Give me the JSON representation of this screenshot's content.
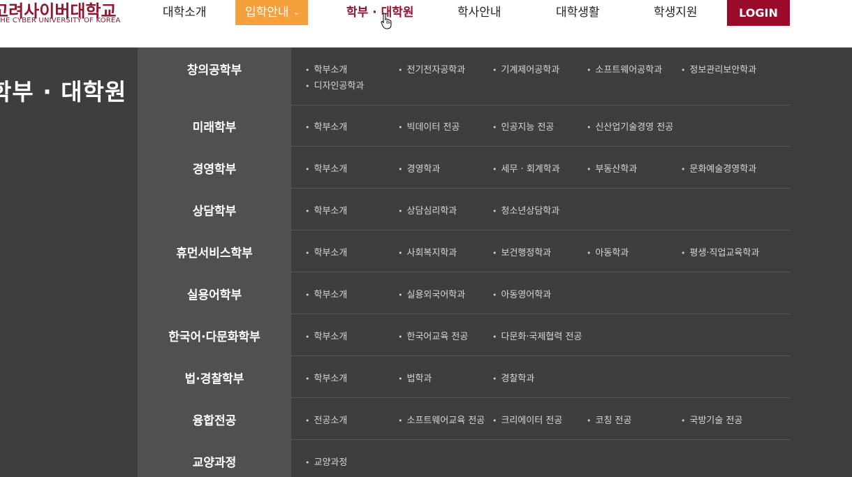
{
  "logo": {
    "ko": "고려사이버대학교",
    "en": "THE CYBER UNIVERSITY OF KOREA"
  },
  "gnb": {
    "items": [
      "대학소개",
      "입학안내",
      "학부 · 대학원",
      "학사안내",
      "대학생활",
      "학생지원"
    ],
    "dropdown_chevron": "⌄",
    "login": "LOGIN"
  },
  "section_title": "학부 · 대학원",
  "menu": [
    {
      "label": "창의공학부",
      "links": [
        "학부소개",
        "전기전자공학과",
        "기계제어공학과",
        "소프트웨어공학과",
        "정보관리보안학과",
        "디자인공학과"
      ]
    },
    {
      "label": "미래학부",
      "links": [
        "학부소개",
        "빅데이터 전공",
        "인공지능 전공",
        "신산업기술경영 전공"
      ]
    },
    {
      "label": "경영학부",
      "links": [
        "학부소개",
        "경영학과",
        "세무 · 회계학과",
        "부동산학과",
        "문화예술경영학과"
      ]
    },
    {
      "label": "상담학부",
      "links": [
        "학부소개",
        "상담심리학과",
        "청소년상담학과"
      ]
    },
    {
      "label": "휴먼서비스학부",
      "links": [
        "학부소개",
        "사회복지학과",
        "보건행정학과",
        "아동학과",
        "평생·직업교육학과"
      ]
    },
    {
      "label": "실용어학부",
      "links": [
        "학부소개",
        "실용외국어학과",
        "아동영어학과"
      ]
    },
    {
      "label": "한국어·다문화학부",
      "links": [
        "학부소개",
        "한국어교육 전공",
        "다문화·국제협력 전공"
      ]
    },
    {
      "label": "법·경찰학부",
      "links": [
        "학부소개",
        "법학과",
        "경찰학과"
      ]
    },
    {
      "label": "융합전공",
      "links": [
        "전공소개",
        "소프트웨어교육 전공",
        "크리에이터 전공",
        "코칭 전공",
        "국방기술 전공"
      ]
    },
    {
      "label": "교양과정",
      "links": [
        "교양과정"
      ]
    }
  ]
}
